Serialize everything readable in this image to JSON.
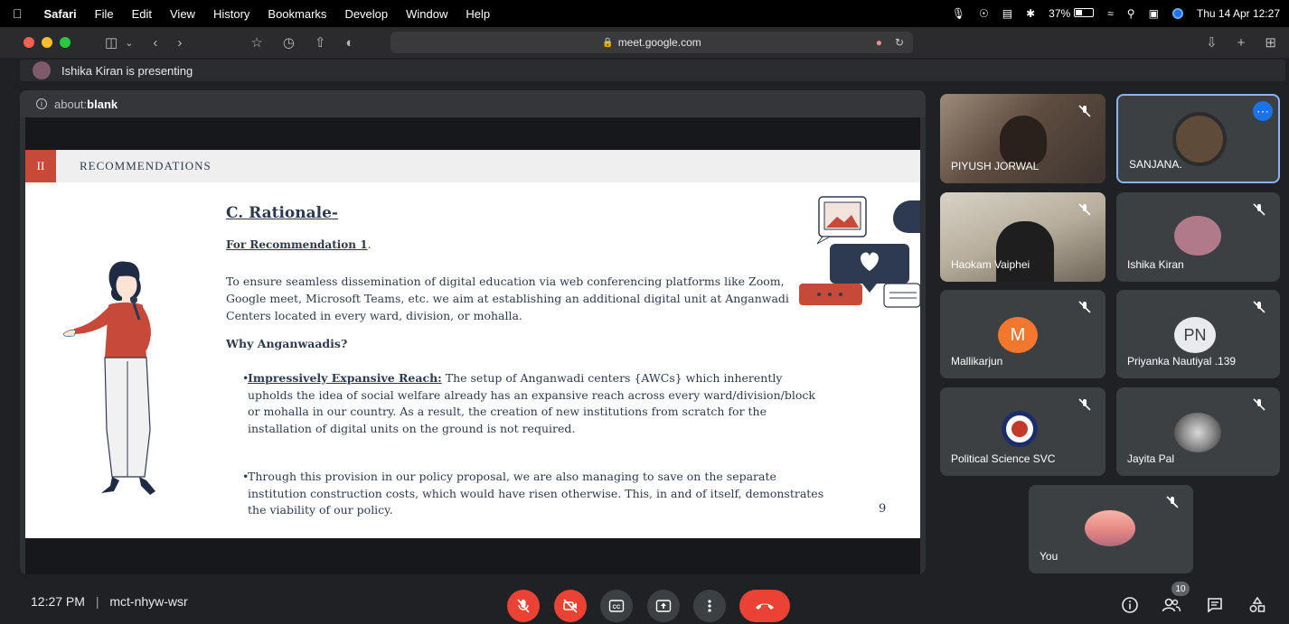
{
  "menubar": {
    "app": "Safari",
    "items": [
      "File",
      "Edit",
      "View",
      "History",
      "Bookmarks",
      "Develop",
      "Window",
      "Help"
    ],
    "battery": "37%",
    "datetime": "Thu 14 Apr  12:27"
  },
  "browser": {
    "url": "meet.google.com"
  },
  "meet": {
    "presenting_text": "Ishika Kiran is presenting",
    "about_scheme": "about:",
    "about_page": "blank",
    "time": "12:27 PM",
    "separator": "|",
    "meeting_code": "mct-nhyw-wsr",
    "participant_count": "10"
  },
  "slide": {
    "section_number": "II",
    "section_title": "RECOMMENDATIONS",
    "title": "C. Rationale-",
    "subtitle": "For Recommendation 1",
    "subtitle_end": ".",
    "paragraph": "To ensure seamless dissemination of digital education via web conferencing platforms like Zoom, Google meet, Microsoft Teams, etc. we aim at establishing an additional digital unit at Anganwadi Centers located in every ward, division, or mohalla.",
    "question": "Why Anganwaadis?",
    "bullet1_head": "Impressively Expansive Reach:",
    "bullet1_body": " The setup of Anganwadi centers {AWCs} which inherently upholds the idea of social welfare already has an expansive reach across every ward/division/block or mohalla in our country. As a result, the creation of new institutions from scratch for the installation of digital units on the ground is not required.",
    "bullet2": "Through this provision in our policy proposal, we are also managing to save on the separate institution construction costs, which would have risen otherwise. This, in and of itself, demonstrates the viability of our policy.",
    "page_number": "9"
  },
  "participants": [
    {
      "name": "PIYUSH JORWAL"
    },
    {
      "name": "SANJANA."
    },
    {
      "name": "Haokam Vaiphei"
    },
    {
      "name": "Ishika Kiran"
    },
    {
      "name": "Mallikarjun",
      "initials": "M",
      "color": "#f4772e"
    },
    {
      "name": "Priyanka Nautiyal .139",
      "initials": "PN",
      "color": "#e8eaed"
    },
    {
      "name": "Political Science SVC"
    },
    {
      "name": "Jayita Pal"
    },
    {
      "name": "You"
    }
  ]
}
